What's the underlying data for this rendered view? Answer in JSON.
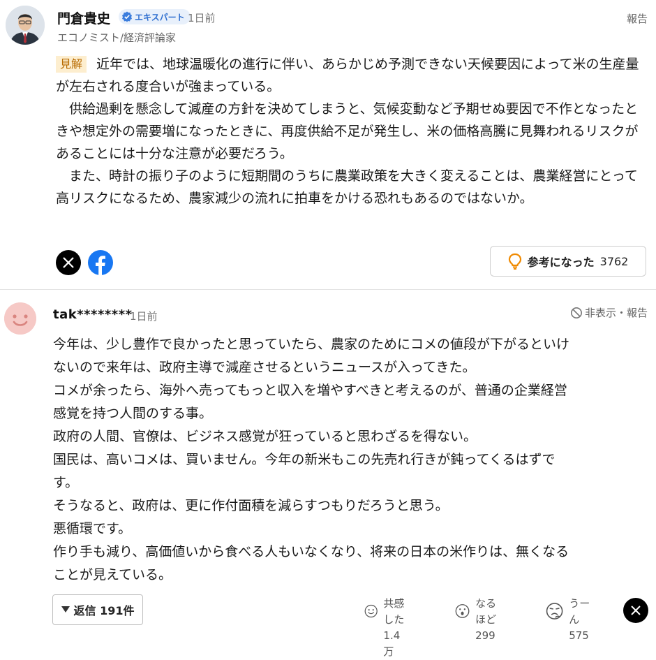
{
  "expert_comment": {
    "author": "門倉貴史",
    "badge_label": "エキスパート",
    "posted": "1日前",
    "profession": "エコノミスト/経済評論家",
    "report_label": "報告",
    "tag": "見解",
    "paragraphs": [
      "近年では、地球温暖化の進行に伴い、あらかじめ予測できない天候要因によって米の生産量が左右される度合いが強まっている。",
      "　供給過剰を懸念して減産の方針を決めてしまうと、気候変動など予期せぬ要因で不作となったときや想定外の需要増になったときに、再度供給不足が発生し、米の価格高騰に見舞われるリスクがあることには十分な注意が必要だろう。",
      "　また、時計の振り子のように短期間のうちに農業政策を大きく変えることは、農業経営にとって高リスクになるため、農家減少の流れに拍車をかける恐れもあるのではないか。"
    ],
    "helpful_label": "参考になった",
    "helpful_count": "3762",
    "share_icons": [
      "x-icon",
      "facebook-icon"
    ]
  },
  "user_comment": {
    "username": "tak********",
    "posted": "1日前",
    "hide_report_label": "非表示・報告",
    "lines": [
      "今年は、少し豊作で良かったと思っていたら、農家のためにコメの値段が下がるといけ",
      "ないので来年は、政府主導で減産させるというニュースが入ってきた。",
      "コメが余ったら、海外へ売ってもっと収入を増やすべきと考えるのが、普通の企業経営",
      "感覚を持つ人間のする事。",
      "政府の人間、官僚は、ビジネス感覚が狂っていると思わざるを得ない。",
      "国民は、高いコメは、買いません。今年の新米もこの先売れ行きが鈍ってくるはずで",
      "す。",
      "そうなると、政府は、更に作付面積を減らすつもりだろうと思う。",
      "悪循環です。",
      "作り手も減り、高価値いから食べる人もいなくなり、将来の日本の米作りは、無くなる",
      "ことが見えている。"
    ],
    "reply_label": "返信 191件",
    "reactions": [
      {
        "label": "共感した",
        "count": "1.4万",
        "icon": "smile-icon"
      },
      {
        "label": "なるほど",
        "count": "299",
        "icon": "surprised-icon"
      },
      {
        "label": "うーん",
        "count": "575",
        "icon": "thinking-icon"
      }
    ]
  }
}
